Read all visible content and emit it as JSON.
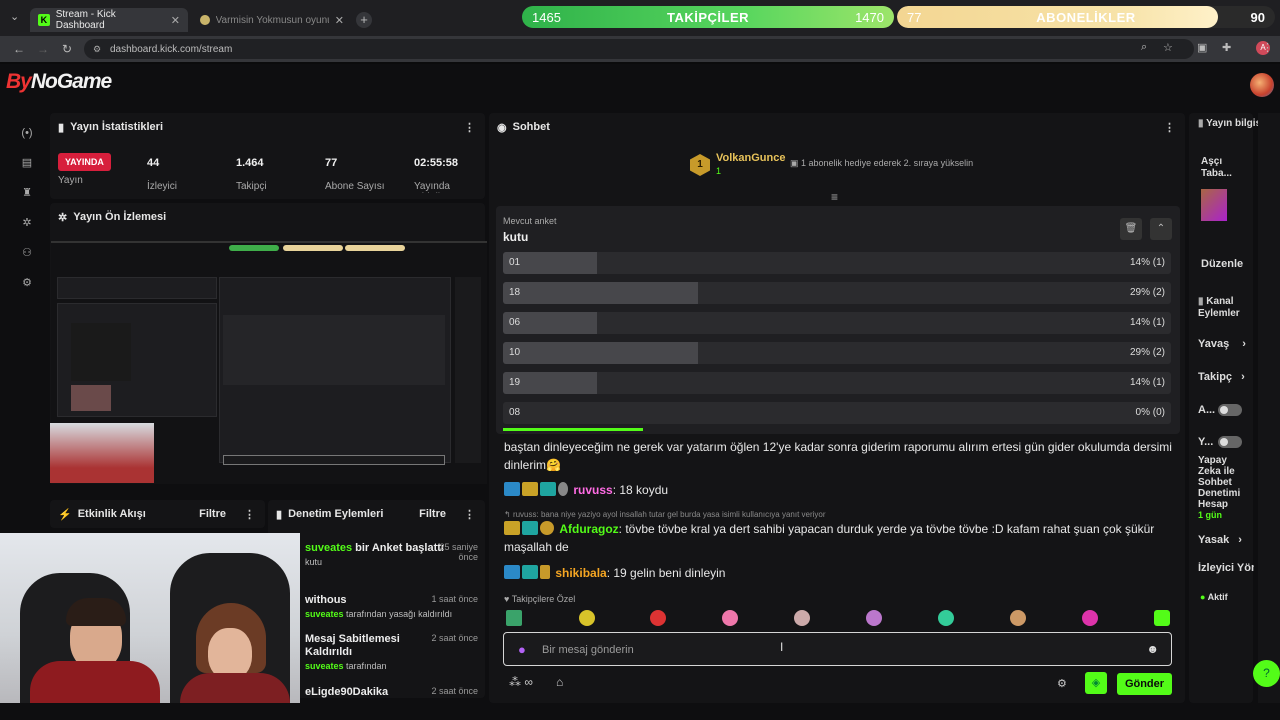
{
  "browser": {
    "tab1": "Stream - Kick Dashboard",
    "tab2": "Varmisin Yokmusun oyunu oy...",
    "url": "dashboard.kick.com/stream",
    "profile_initial": "A"
  },
  "overlay": {
    "followers": {
      "current": "1465",
      "label": "TAKİPÇİLER",
      "goal": "1470",
      "progress": 0.99
    },
    "subs": {
      "current": "77",
      "label": "ABONELİKLER",
      "goal": "90",
      "progress": 0.86
    }
  },
  "logo": {
    "text1": "By",
    "text2": "NoGame"
  },
  "stats": {
    "title": "Yayın İstatistikleri",
    "live_badge": "YAYINDA",
    "items": [
      {
        "value": "",
        "label": "Yayın"
      },
      {
        "value": "44",
        "label": "İzleyici"
      },
      {
        "value": "1.464",
        "label": "Takipçi"
      },
      {
        "value": "77",
        "label": "Abone Sayısı"
      },
      {
        "value": "02:55:58",
        "label": "Yayında Olduğu Süre"
      }
    ]
  },
  "preview": {
    "title": "Yayın Ön İzlemesi"
  },
  "activity": {
    "title": "Etkinlik Akışı",
    "filter": "Filtre"
  },
  "moderation": {
    "title": "Denetim Eylemleri",
    "filter": "Filtre",
    "rows": [
      {
        "user": "suveates",
        "title": " bir Anket başlattı",
        "sub": "kutu",
        "time": "25 saniye önce"
      },
      {
        "title": "withous",
        "user": "suveates",
        "sub": " tarafından yasağı kaldırıldı",
        "time": "1 saat önce"
      },
      {
        "title": "Mesaj Sabitlemesi Kaldırıldı",
        "user": "suveates",
        "sub": " tarafından",
        "time": "2 saat önce"
      },
      {
        "title": "eLigde90Dakika",
        "time": "2 saat önce"
      }
    ]
  },
  "chat": {
    "title": "Sohbet",
    "pinned_user": "VolkanGunce",
    "pinned_count": "1",
    "pinned_rank": "1",
    "pinned_text": "1 abonelik hediye ederek 2. sıraya yükselin",
    "poll": {
      "label": "Mevcut anket",
      "question": "kutu",
      "options": [
        {
          "label": "01",
          "pct": 14,
          "text": "14% (1)"
        },
        {
          "label": "18",
          "pct": 29,
          "text": "29% (2)"
        },
        {
          "label": "06",
          "pct": 14,
          "text": "14% (1)"
        },
        {
          "label": "10",
          "pct": 29,
          "text": "29% (2)"
        },
        {
          "label": "19",
          "pct": 14,
          "text": "14% (1)"
        },
        {
          "label": "08",
          "pct": 0,
          "text": "0% (0)"
        }
      ]
    },
    "messages": [
      {
        "text": "baştan dinleyeceğim ne gerek var yatarım öğlen 12'ye kadar sonra giderim raporumu alırım ertesi gün gider okulumda dersimi dinlerim🤗"
      },
      {
        "user": "ruvuss",
        "text": ": 18 koydu"
      },
      {
        "reply": "ruvuss: bana niye yaziyo ayol insallah tutar gel burda yasa isimli kullanıcıya yanıt veriyor"
      },
      {
        "user": "Afduragoz",
        "text": ": tövbe tövbe kral ya dert sahibi yapacan durduk yerde ya tövbe tövbe :D kafam rahat şuan çok şükür maşallah de"
      },
      {
        "user": "shikibala",
        "text": ": 19 gelin beni dinleyin"
      }
    ],
    "followers_only": "Takipçilere Özel",
    "input_placeholder": "Bir mesaj gönderin",
    "send": "Gönder",
    "infinity": "∞"
  },
  "right": {
    "stream_info": "Yayın bilgisi",
    "category": "Aşçı Taba...",
    "edit": "Düzenle",
    "channel_actions": "Kanal Eylemler",
    "slow": "Yavaş",
    "followers": "Takipç",
    "a": "A...",
    "y": "Y...",
    "ai": "Yapay Zeka ile Sohbet Denetimi Hesap",
    "ai_days": "1 gün",
    "ban": "Yasak",
    "viewer": "İzleyici Yön",
    "active": "Aktif"
  },
  "colors": {
    "kick_green": "#53fc18",
    "live_red": "#d71f3c",
    "panel": "#141416"
  }
}
